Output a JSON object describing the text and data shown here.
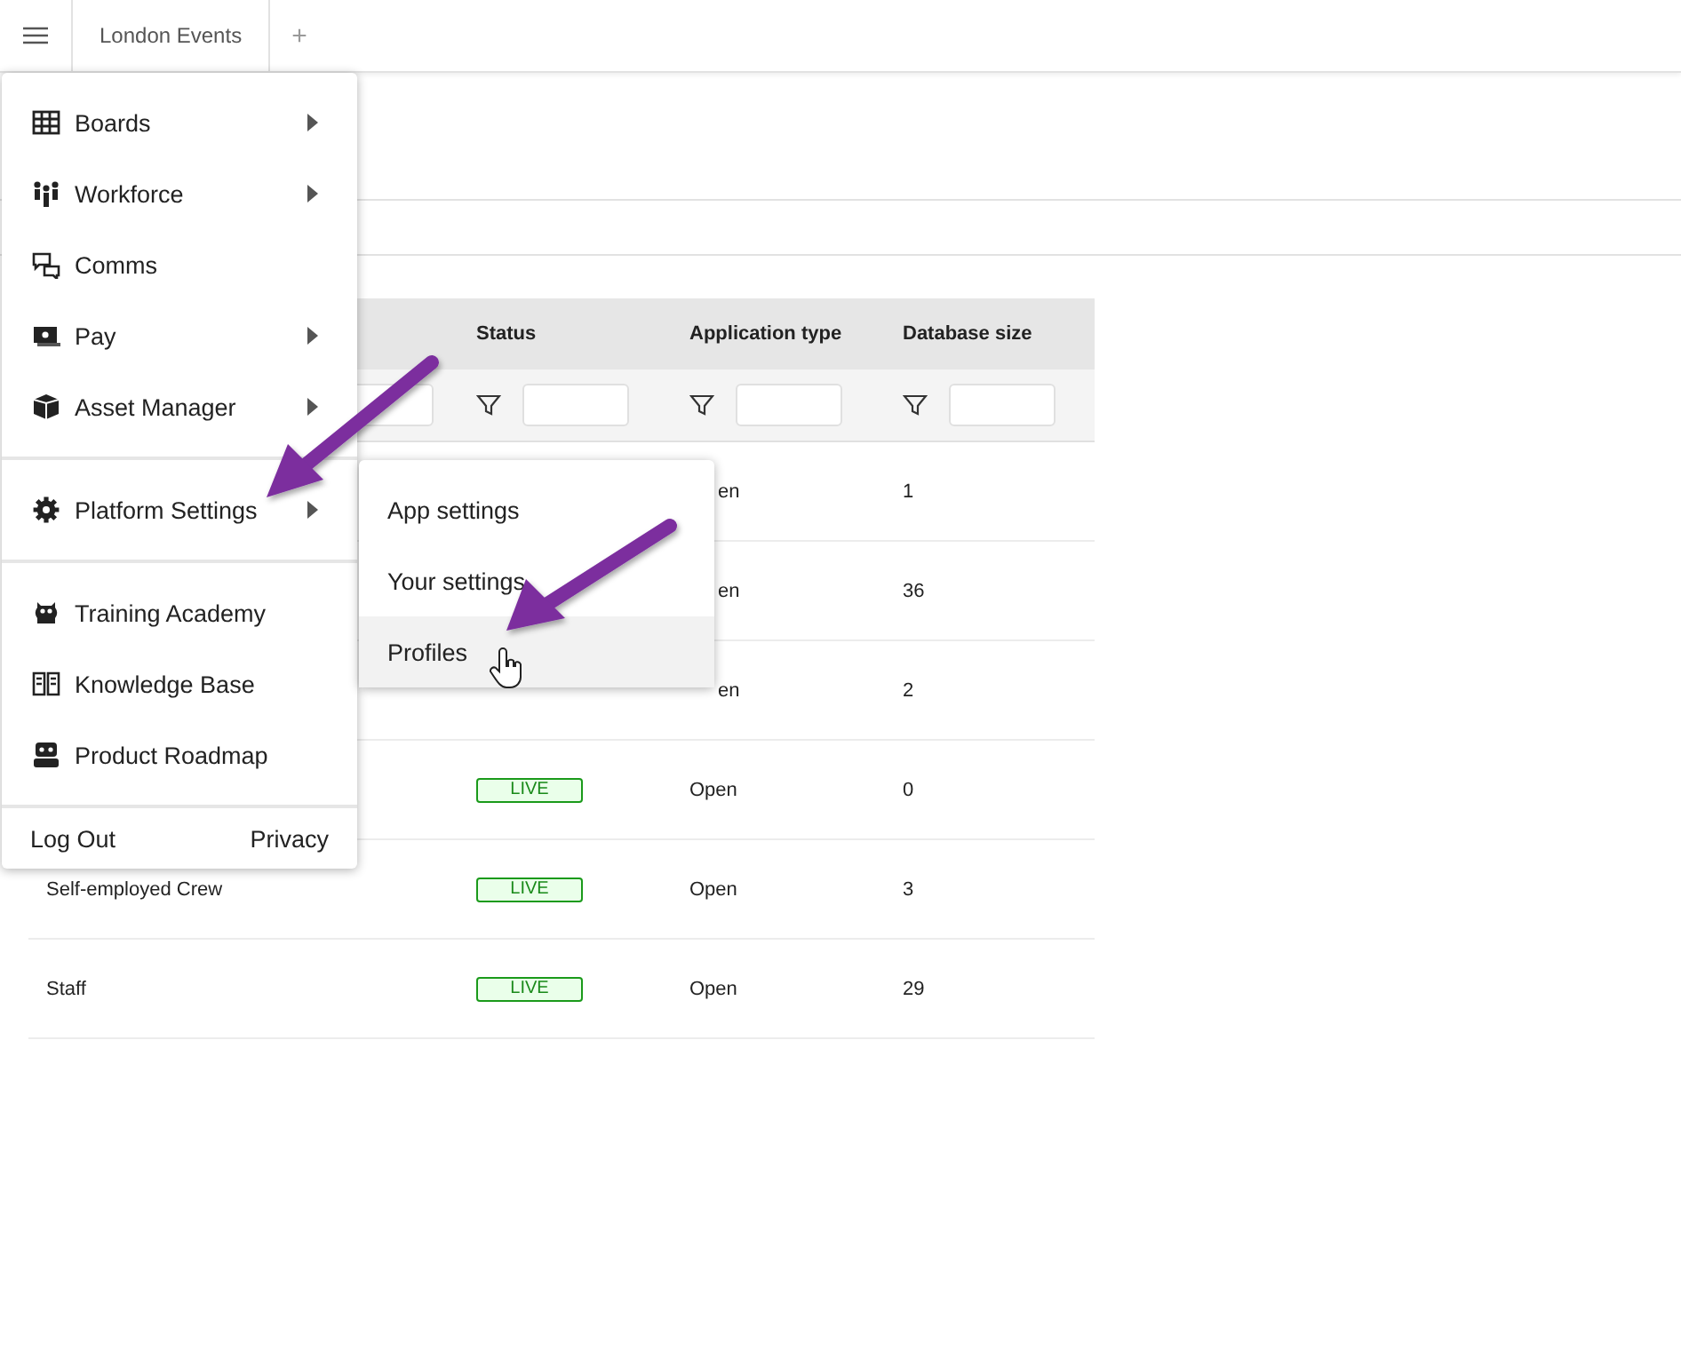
{
  "top_bar": {
    "tabs": [
      {
        "label": "London Events",
        "selected": true
      }
    ],
    "add_tab": "+"
  },
  "table": {
    "columns": [
      "Status",
      "Application type",
      "Database size"
    ],
    "rows": [
      {
        "database_size": "1",
        "application_type": "en",
        "covered": true
      },
      {
        "database_size": "36",
        "application_type": "en",
        "covered": true
      },
      {
        "database_size": "2",
        "application_type": "en",
        "covered": true
      },
      {
        "status": "LIVE",
        "application_type": "Open",
        "database_size": "0"
      },
      {
        "name": "Self-employed Crew",
        "status": "LIVE",
        "application_type": "Open",
        "database_size": "3"
      },
      {
        "name": "Staff",
        "status": "LIVE",
        "application_type": "Open",
        "database_size": "29"
      }
    ]
  },
  "menu": {
    "groups": [
      [
        {
          "label": "Boards",
          "has_submenu": true
        },
        {
          "label": "Workforce",
          "has_submenu": true
        },
        {
          "label": "Comms",
          "has_submenu": false
        },
        {
          "label": "Pay",
          "has_submenu": true
        },
        {
          "label": "Asset Manager",
          "has_submenu": true
        }
      ],
      [
        {
          "label": "Platform Settings",
          "has_submenu": true
        }
      ],
      [
        {
          "label": "Training Academy",
          "has_submenu": false
        },
        {
          "label": "Knowledge Base",
          "has_submenu": false
        },
        {
          "label": "Product Roadmap",
          "has_submenu": false
        }
      ]
    ],
    "footer": [
      "Log Out",
      "Privacy"
    ]
  },
  "submenu": {
    "items": [
      {
        "label": "App settings",
        "selected": false
      },
      {
        "label": "Your settings",
        "selected": false
      },
      {
        "label": "Profiles",
        "selected": true
      }
    ]
  }
}
